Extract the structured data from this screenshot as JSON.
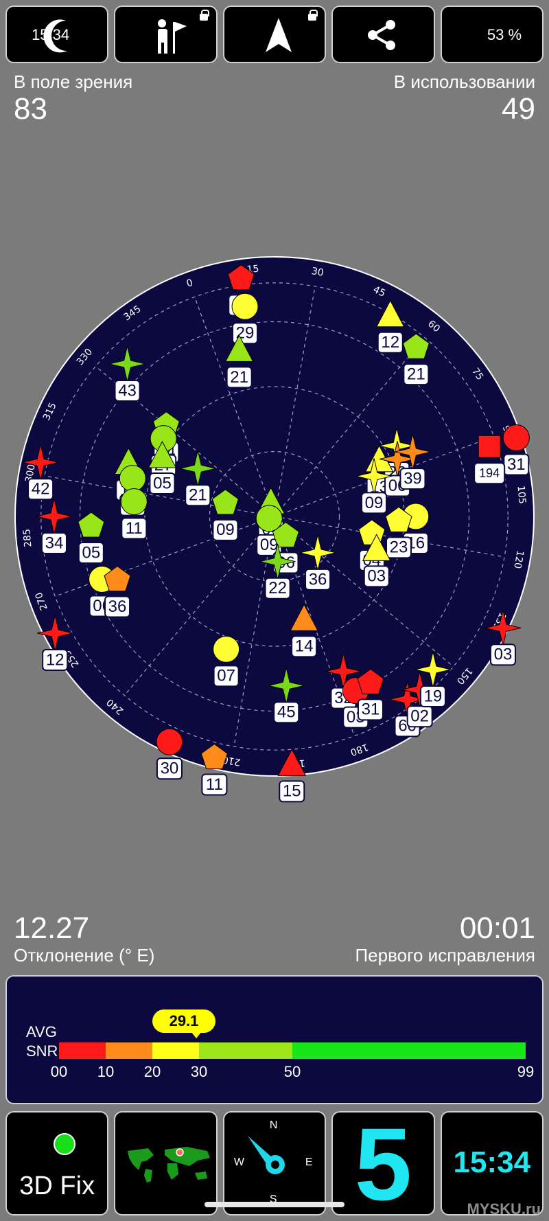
{
  "status_bar": {
    "time": "15:34",
    "battery": "53 %"
  },
  "header": {
    "in_view_label": "В поле зрения",
    "in_view_value": "83",
    "in_use_label": "В использовании",
    "in_use_value": "49"
  },
  "sky": {
    "azimuth_labels": [
      "0",
      "15",
      "30",
      "45",
      "60",
      "75",
      "90",
      "105",
      "120",
      "135",
      "150",
      "165",
      "180",
      "195",
      "210",
      "225",
      "240",
      "255",
      "270",
      "285",
      "300",
      "315",
      "330",
      "345"
    ],
    "satellites": [
      {
        "id": "42",
        "shape": "star",
        "color": "#ff1a1a",
        "az": 303,
        "el": 5
      },
      {
        "id": "11",
        "shape": "triangle",
        "color": "#98e61a",
        "az": 310,
        "el": 35
      },
      {
        "id": "34",
        "shape": "star",
        "color": "#ff1a1a",
        "az": 290,
        "el": 12
      },
      {
        "id": "05",
        "shape": "pentagon",
        "color": "#98e61a",
        "az": 287,
        "el": 25
      },
      {
        "id": "43",
        "shape": "star",
        "color": "#7bd91c",
        "az": 336,
        "el": 15
      },
      {
        "id": "15",
        "shape": "pentagon",
        "color": "#ff1a1a",
        "az": 12,
        "el": 5
      },
      {
        "id": "29",
        "shape": "circle",
        "color": "#ffff33",
        "az": 12,
        "el": 15
      },
      {
        "id": "21",
        "shape": "triangle",
        "color": "#98e61a",
        "az": 8,
        "el": 30
      },
      {
        "id": "34",
        "shape": "pentagon",
        "color": "#98e61a",
        "az": 330,
        "el": 40
      },
      {
        "id": "27",
        "shape": "circle",
        "color": "#98e61a",
        "az": 325,
        "el": 42
      },
      {
        "id": "30",
        "shape": "circle",
        "color": "#98e61a",
        "az": 305,
        "el": 38
      },
      {
        "id": "05",
        "shape": "triangle",
        "color": "#98e61a",
        "az": 318,
        "el": 45
      },
      {
        "id": "11",
        "shape": "circle",
        "color": "#98e61a",
        "az": 296,
        "el": 40
      },
      {
        "id": "12",
        "shape": "star",
        "color": "#ff1a1a",
        "az": 262,
        "el": 2
      },
      {
        "id": "21",
        "shape": "star",
        "color": "#7bd91c",
        "az": 322,
        "el": 58
      },
      {
        "id": "06",
        "shape": "circle",
        "color": "#ffff33",
        "az": 270,
        "el": 25
      },
      {
        "id": "36",
        "shape": "pentagon",
        "color": "#ff8c1a",
        "az": 268,
        "el": 30
      },
      {
        "id": "12",
        "shape": "triangle",
        "color": "#ffff33",
        "az": 50,
        "el": 8
      },
      {
        "id": "21",
        "shape": "pentagon",
        "color": "#98e61a",
        "az": 60,
        "el": 12
      },
      {
        "id": "09",
        "shape": "pentagon",
        "color": "#98e61a",
        "az": 305,
        "el": 72
      },
      {
        "id": "04",
        "shape": "triangle",
        "color": "#98e61a",
        "az": 5,
        "el": 85
      },
      {
        "id": "09",
        "shape": "circle",
        "color": "#98e61a",
        "az": 270,
        "el": 88
      },
      {
        "id": "06",
        "shape": "pentagon",
        "color": "#98e61a",
        "az": 170,
        "el": 82
      },
      {
        "id": "30",
        "shape": "circle",
        "color": "#ff1a1a",
        "az": 225,
        "el": 2
      },
      {
        "id": "07",
        "shape": "circle",
        "color": "#ffff33",
        "az": 220,
        "el": 40
      },
      {
        "id": "31",
        "shape": "circle",
        "color": "#ff1a1a",
        "az": 92,
        "el": 0
      },
      {
        "id": "26",
        "shape": "star",
        "color": "#ffff33",
        "az": 80,
        "el": 40
      },
      {
        "id": "13",
        "shape": "triangle",
        "color": "#ffff33",
        "az": 82,
        "el": 48
      },
      {
        "id": "06",
        "shape": "star",
        "color": "#ff8c1a",
        "az": 85,
        "el": 42
      },
      {
        "id": "39",
        "shape": "star",
        "color": "#ff8c1a",
        "az": 85,
        "el": 36
      },
      {
        "id": "194",
        "shape": "square",
        "color": "#ff1a1a",
        "az": 92,
        "el": 10
      },
      {
        "id": "09",
        "shape": "star",
        "color": "#ffff33",
        "az": 88,
        "el": 52
      },
      {
        "id": "22",
        "shape": "star",
        "color": "#7bd91c",
        "az": 196,
        "el": 74
      },
      {
        "id": "36",
        "shape": "star",
        "color": "#ffff33",
        "az": 150,
        "el": 70
      },
      {
        "id": "04",
        "shape": "pentagon",
        "color": "#ffff33",
        "az": 120,
        "el": 55
      },
      {
        "id": "16",
        "shape": "circle",
        "color": "#ffff33",
        "az": 110,
        "el": 40
      },
      {
        "id": "23",
        "shape": "pentagon",
        "color": "#ffff33",
        "az": 112,
        "el": 46
      },
      {
        "id": "03",
        "shape": "triangle",
        "color": "#ffff33",
        "az": 128,
        "el": 52
      },
      {
        "id": "11",
        "shape": "pentagon",
        "color": "#ff8c1a",
        "az": 214,
        "el": 2
      },
      {
        "id": "45",
        "shape": "star",
        "color": "#7bd91c",
        "az": 196,
        "el": 30
      },
      {
        "id": "14",
        "shape": "triangle",
        "color": "#ff8c1a",
        "az": 184,
        "el": 52
      },
      {
        "id": "15",
        "shape": "triangle",
        "color": "#ff1a1a",
        "az": 196,
        "el": 2
      },
      {
        "id": "32",
        "shape": "star",
        "color": "#ff1a1a",
        "az": 176,
        "el": 30
      },
      {
        "id": "03",
        "shape": "circle",
        "color": "#ff1a1a",
        "az": 175,
        "el": 22
      },
      {
        "id": "31",
        "shape": "pentagon",
        "color": "#ff1a1a",
        "az": 170,
        "el": 22
      },
      {
        "id": "60",
        "shape": "star",
        "color": "#ff1a1a",
        "az": 164,
        "el": 10
      },
      {
        "id": "02",
        "shape": "star",
        "color": "#ff1a1a",
        "az": 160,
        "el": 10
      },
      {
        "id": "19",
        "shape": "star",
        "color": "#ffff33",
        "az": 154,
        "el": 12
      },
      {
        "id": "03",
        "shape": "star",
        "color": "#ff1a1a",
        "az": 136,
        "el": 0
      }
    ]
  },
  "footer_stats": {
    "declination_value": "12.27",
    "declination_label": "Отклонение (° E)",
    "ttff_value": "00:01",
    "ttff_label": "Первого исправления"
  },
  "snr": {
    "avg_label": "AVG",
    "snr_label": "SNR",
    "avg_value": "29.1",
    "ticks": [
      "00",
      "10",
      "20",
      "30",
      "50",
      "99"
    ],
    "segments": [
      {
        "color": "#ff1a1a",
        "span": 10
      },
      {
        "color": "#ff8c1a",
        "span": 10
      },
      {
        "color": "#ffff1a",
        "span": 10
      },
      {
        "color": "#9ee61a",
        "span": 20
      },
      {
        "color": "#19e619",
        "span": 50
      }
    ]
  },
  "bottom_bar": {
    "fix_label": "3D Fix",
    "fix_color": "#18e018",
    "compass": {
      "n": "N",
      "e": "E",
      "s": "S",
      "w": "W"
    },
    "satellite_count": "5",
    "clock": "15:34"
  },
  "watermark": "MYSKU.ru",
  "colors": {
    "sky_background": "#0b0940",
    "accent": "#1fe6f0",
    "screen_background": "#7b7b7b"
  }
}
